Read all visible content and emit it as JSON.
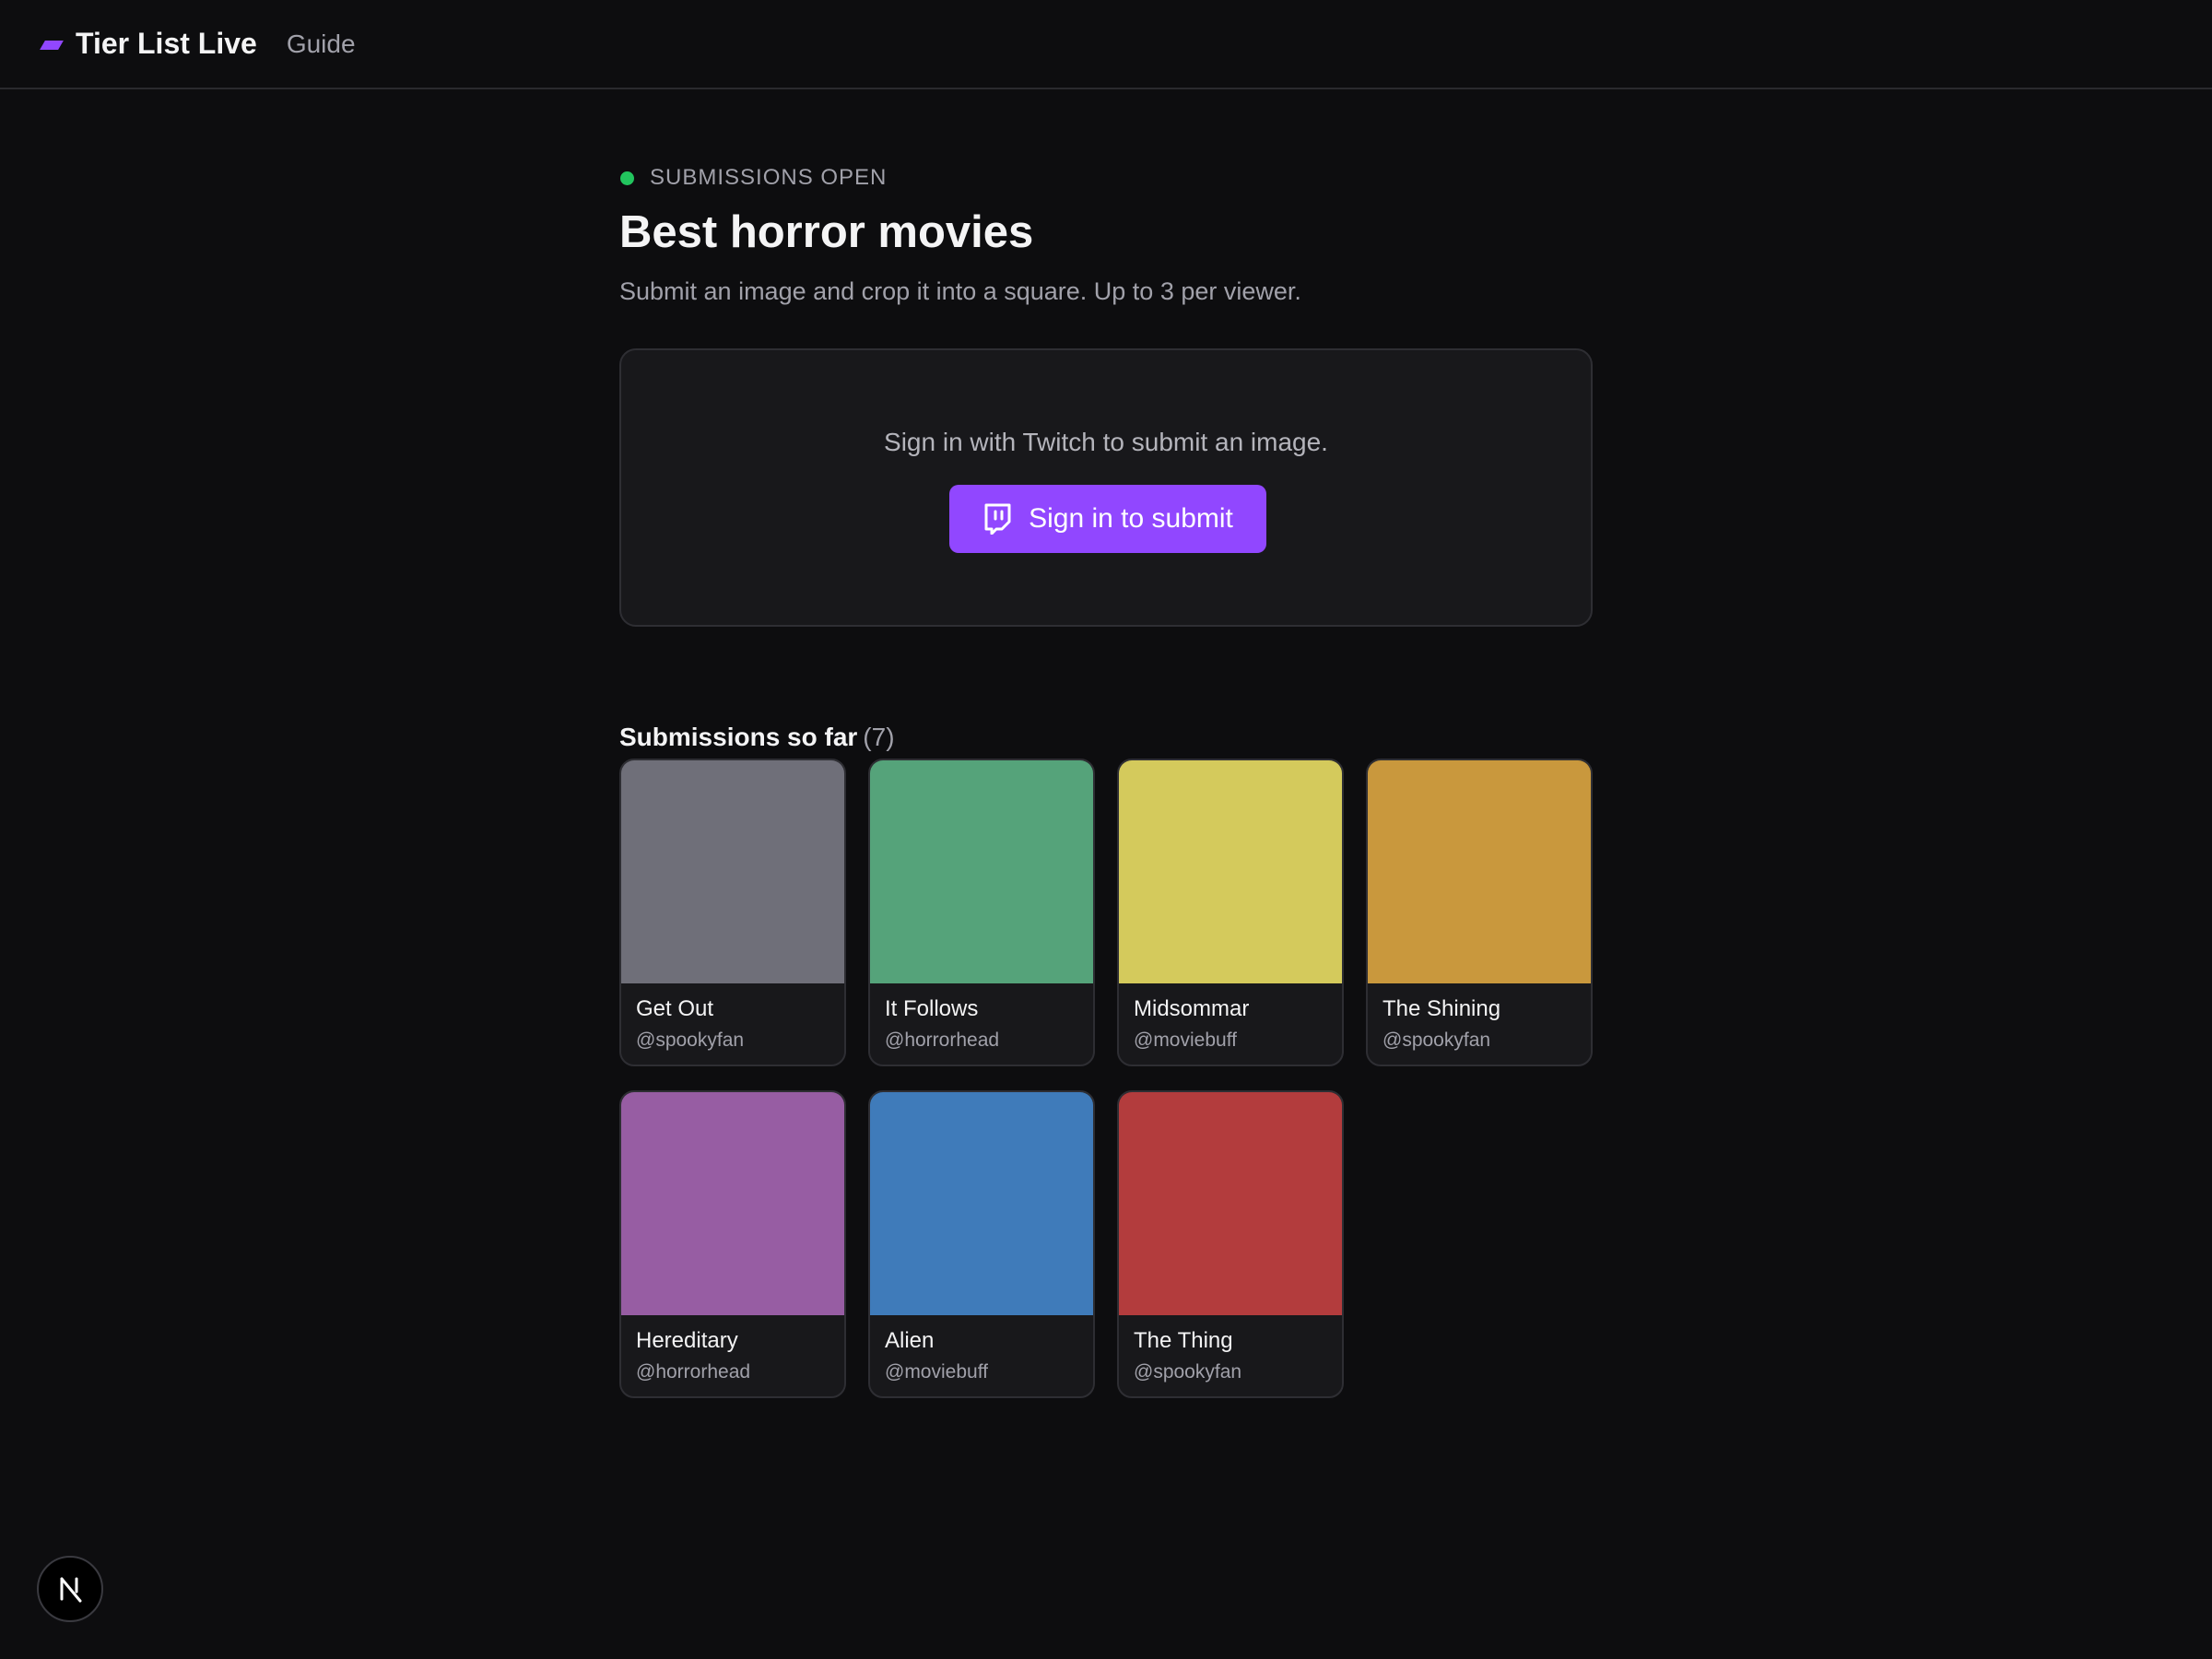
{
  "header": {
    "brand": "Tier List Live",
    "nav_guide": "Guide",
    "brand_color": "#9147ff"
  },
  "status": {
    "label": "SUBMISSIONS OPEN",
    "color": "#22c55e"
  },
  "page": {
    "title": "Best horror movies",
    "subtitle": "Submit an image and crop it into a square. Up to 3 per viewer."
  },
  "signin": {
    "prompt": "Sign in with Twitch to submit an image.",
    "button_label": "Sign in to submit",
    "button_icon": "twitch-icon"
  },
  "submissions": {
    "heading": "Submissions so far",
    "count": "(7)",
    "items": [
      {
        "title": "Get Out",
        "user": "@spookyfan",
        "color": "#6f6f79"
      },
      {
        "title": "It Follows",
        "user": "@horrorhead",
        "color": "#55a37a"
      },
      {
        "title": "Midsommar",
        "user": "@moviebuff",
        "color": "#d4ca5c"
      },
      {
        "title": "The Shining",
        "user": "@spookyfan",
        "color": "#c9983d"
      },
      {
        "title": "Hereditary",
        "user": "@horrorhead",
        "color": "#975da3"
      },
      {
        "title": "Alien",
        "user": "@moviebuff",
        "color": "#3f7bba"
      },
      {
        "title": "The Thing",
        "user": "@spookyfan",
        "color": "#b33c3d"
      }
    ]
  },
  "dev_badge": {
    "icon": "next-logo-icon"
  }
}
